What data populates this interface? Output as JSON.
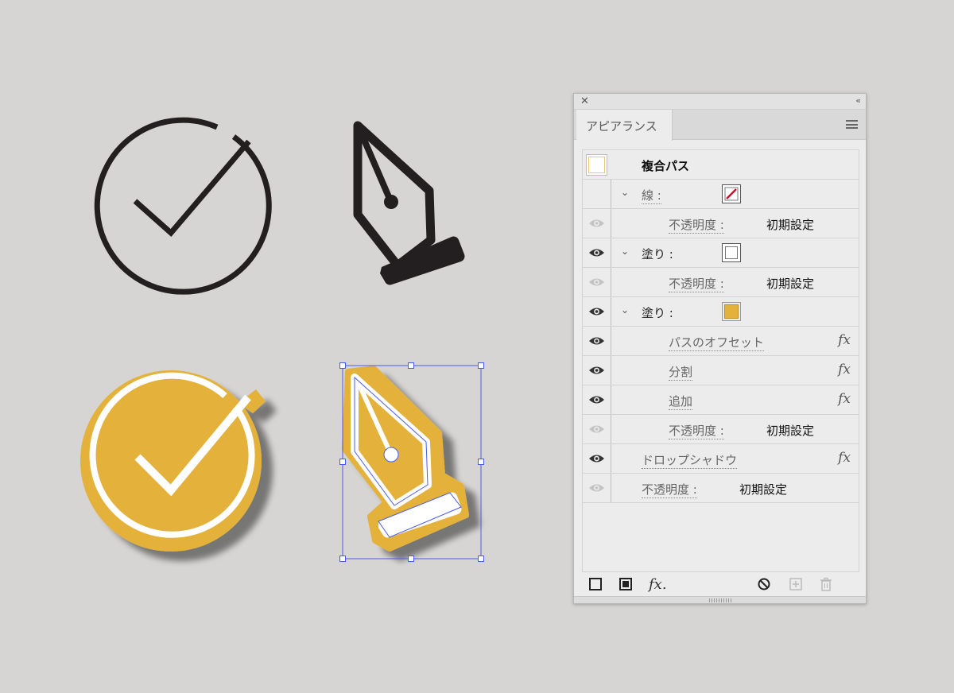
{
  "colors": {
    "accent_gold": "#e4b13a",
    "stroke_dark": "#231f20",
    "selection_blue": "#4a5cf0",
    "panel_bg": "#ececec"
  },
  "artwork": {
    "icons": [
      "check-circle-outline",
      "pen-nib-outline",
      "check-circle-sticker",
      "pen-nib-sticker"
    ]
  },
  "panel": {
    "close_glyph": "✕",
    "collapse_glyph": "‹‹",
    "tab_label": "アピアランス",
    "rows": [
      {
        "name": "object-row",
        "label": "複合パス",
        "eye": "none",
        "chevron": false,
        "bold": true
      },
      {
        "name": "stroke-row",
        "label": "線 :",
        "eye": "none",
        "chevron": true,
        "swatch": "none-red-slash"
      },
      {
        "name": "stroke-opacity-row",
        "label": "不透明度 :",
        "value": "初期設定",
        "eye": "dim"
      },
      {
        "name": "fill-row-1",
        "label": "塗り :",
        "eye": "on",
        "chevron": true,
        "swatch": "white"
      },
      {
        "name": "fill1-opacity-row",
        "label": "不透明度 :",
        "value": "初期設定",
        "eye": "dim"
      },
      {
        "name": "fill-row-2",
        "label": "塗り :",
        "eye": "on",
        "chevron": true,
        "swatch": "gold"
      },
      {
        "name": "effect-offset-path-row",
        "label": "パスのオフセット",
        "eye": "on",
        "fx": "fx"
      },
      {
        "name": "effect-divide-row",
        "label": "分割",
        "eye": "on",
        "fx": "fx"
      },
      {
        "name": "effect-add-row",
        "label": "追加",
        "eye": "on",
        "fx": "fx"
      },
      {
        "name": "fill2-opacity-row",
        "label": "不透明度 :",
        "value": "初期設定",
        "eye": "dim"
      },
      {
        "name": "drop-shadow-row",
        "label": "ドロップシャドウ",
        "eye": "on",
        "fx": "fx"
      },
      {
        "name": "object-opacity-row",
        "label": "不透明度 :",
        "value": "初期設定",
        "eye": "dim"
      }
    ],
    "bottom_fx": "fx."
  }
}
